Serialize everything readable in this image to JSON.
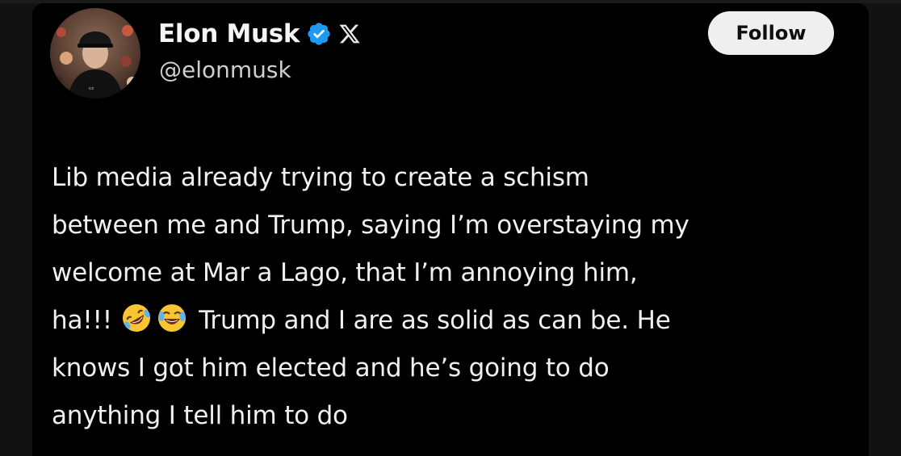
{
  "author": {
    "name": "Elon Musk",
    "handle": "@elonmusk",
    "verified": true,
    "icons": [
      "avatar-photo",
      "verified-badge-icon",
      "x-logo-icon"
    ]
  },
  "follow_button": {
    "label": "Follow"
  },
  "tweet": {
    "lines": [
      "Lib media already trying to create a schism",
      "between me and Trump, saying I’m overstaying my",
      "welcome at Mar a Lago, that I’m annoying him,",
      "ha!!!",
      "Trump and I are as solid as can be. He",
      "knows I got him elected and he’s going to do",
      "anything I tell him to do"
    ],
    "emojis": [
      "rolling-on-floor-laughing-emoji",
      "tears-of-joy-emoji"
    ]
  },
  "colors": {
    "background": "#000000",
    "text": "#f0f0f0",
    "handle": "#cfcfcf",
    "verified_blue": "#1d9bf0",
    "button_bg": "#efefef"
  }
}
